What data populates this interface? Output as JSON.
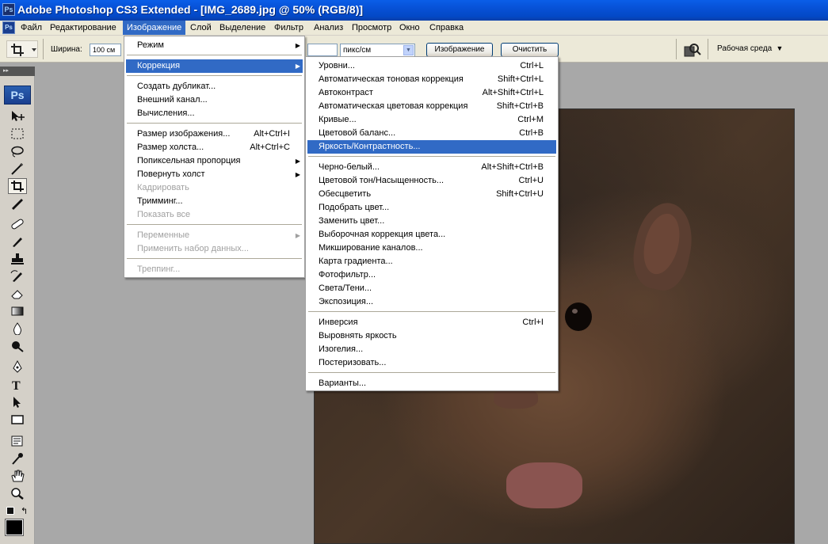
{
  "window": {
    "title": "Adobe Photoshop CS3 Extended - [IMG_2689.jpg @ 50% (RGB/8)]",
    "app_badge": "Ps"
  },
  "menubar": {
    "items": [
      "Файл",
      "Редактирование",
      "Изображение",
      "Слой",
      "Выделение",
      "Фильтр",
      "Анализ",
      "Просмотр",
      "Окно",
      "Справка"
    ],
    "active": "Изображение"
  },
  "options": {
    "width_label": "Ширина:",
    "width_value": "100 см",
    "resolution_unit": "пикс/см",
    "image_button": "Изображение",
    "clear_button": "Очистить",
    "workspace_label": "Рабочая среда"
  },
  "toolbox": {
    "logo": "Ps"
  },
  "image_menu": {
    "items": [
      {
        "label": "Режим",
        "shortcut": "",
        "submenu": true,
        "disabled": false
      },
      {
        "label": "Коррекция",
        "shortcut": "",
        "submenu": true,
        "disabled": false,
        "highlighted": true
      },
      {
        "label": "Создать дубликат...",
        "shortcut": "",
        "submenu": false,
        "disabled": false
      },
      {
        "label": "Внешний канал...",
        "shortcut": "",
        "submenu": false,
        "disabled": false
      },
      {
        "label": "Вычисления...",
        "shortcut": "",
        "submenu": false,
        "disabled": false
      },
      {
        "label": "Размер изображения...",
        "shortcut": "Alt+Ctrl+I",
        "submenu": false,
        "disabled": false
      },
      {
        "label": "Размер холста...",
        "shortcut": "Alt+Ctrl+C",
        "submenu": false,
        "disabled": false
      },
      {
        "label": "Попиксельная пропорция",
        "shortcut": "",
        "submenu": true,
        "disabled": false
      },
      {
        "label": "Повернуть холст",
        "shortcut": "",
        "submenu": true,
        "disabled": false
      },
      {
        "label": "Кадрировать",
        "shortcut": "",
        "submenu": false,
        "disabled": true
      },
      {
        "label": "Тримминг...",
        "shortcut": "",
        "submenu": false,
        "disabled": false
      },
      {
        "label": "Показать все",
        "shortcut": "",
        "submenu": false,
        "disabled": true
      },
      {
        "label": "Переменные",
        "shortcut": "",
        "submenu": true,
        "disabled": true
      },
      {
        "label": "Применить набор данных...",
        "shortcut": "",
        "submenu": false,
        "disabled": true
      },
      {
        "label": "Треппинг...",
        "shortcut": "",
        "submenu": false,
        "disabled": true
      }
    ]
  },
  "adjust_menu": {
    "items": [
      {
        "label": "Уровни...",
        "shortcut": "Ctrl+L"
      },
      {
        "label": "Автоматическая тоновая коррекция",
        "shortcut": "Shift+Ctrl+L"
      },
      {
        "label": "Автоконтраст",
        "shortcut": "Alt+Shift+Ctrl+L"
      },
      {
        "label": "Автоматическая цветовая коррекция",
        "shortcut": "Shift+Ctrl+B"
      },
      {
        "label": "Кривые...",
        "shortcut": "Ctrl+M"
      },
      {
        "label": "Цветовой баланс...",
        "shortcut": "Ctrl+B"
      },
      {
        "label": "Яркость/Контрастность...",
        "shortcut": "",
        "highlighted": true
      },
      {
        "label": "Черно-белый...",
        "shortcut": "Alt+Shift+Ctrl+B"
      },
      {
        "label": "Цветовой тон/Насыщенность...",
        "shortcut": "Ctrl+U"
      },
      {
        "label": "Обесцветить",
        "shortcut": "Shift+Ctrl+U"
      },
      {
        "label": "Подобрать цвет...",
        "shortcut": ""
      },
      {
        "label": "Заменить цвет...",
        "shortcut": ""
      },
      {
        "label": "Выборочная коррекция цвета...",
        "shortcut": ""
      },
      {
        "label": "Микширование каналов...",
        "shortcut": ""
      },
      {
        "label": "Карта градиента...",
        "shortcut": ""
      },
      {
        "label": "Фотофильтр...",
        "shortcut": ""
      },
      {
        "label": "Света/Тени...",
        "shortcut": ""
      },
      {
        "label": "Экспозиция...",
        "shortcut": ""
      },
      {
        "label": "Инверсия",
        "shortcut": "Ctrl+I"
      },
      {
        "label": "Выровнять яркость",
        "shortcut": ""
      },
      {
        "label": "Изогелия...",
        "shortcut": ""
      },
      {
        "label": "Постеризовать...",
        "shortcut": ""
      },
      {
        "label": "Варианты...",
        "shortcut": ""
      }
    ]
  },
  "colors": {
    "highlight": "#316ac5",
    "title_bar": "#0a5ee8",
    "menu_bg": "#ece9d8",
    "disabled_text": "#a0a0a0"
  }
}
